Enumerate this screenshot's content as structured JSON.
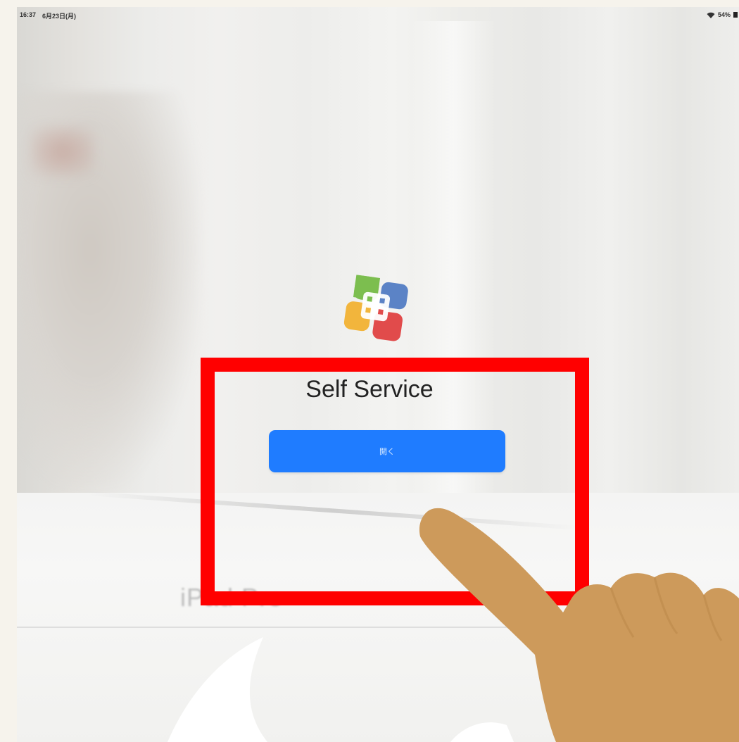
{
  "status_bar": {
    "time": "16:37",
    "date": "6月23日(月)",
    "battery": "54%"
  },
  "app": {
    "title": "Self Service",
    "open_button_label": "開く"
  },
  "background": {
    "box_brand_text": "iPad Pro"
  },
  "overlay": {
    "highlight_color": "#ff0000",
    "hand_color": "#cd9a5b",
    "arrow_color": "#ffffff"
  },
  "icons": [
    "wifi-icon",
    "battery-icon",
    "self-service-logo-icon",
    "pointing-hand-icon",
    "curved-arrow-icon"
  ]
}
